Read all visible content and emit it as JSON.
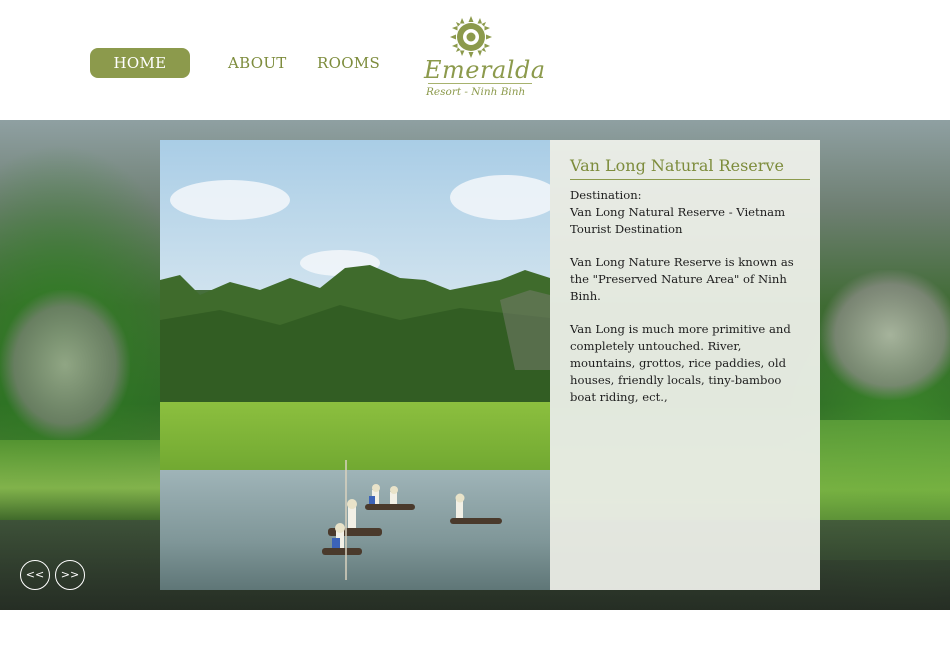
{
  "nav": {
    "home": "HOME",
    "about": "ABOUT",
    "rooms": "ROOMS"
  },
  "logo": {
    "name": "Emeralda",
    "subtitle": "Resort - Ninh Binh"
  },
  "slide": {
    "title": "Van Long Natural Reserve",
    "destination_label": "Destination:",
    "destination_value": "Van Long Natural Reserve - Vietnam Tourist Destination",
    "paragraph_1": "Van Long Nature Reserve is known as the \"Preserved Nature Area\" of Ninh Binh.",
    "paragraph_2": "Van Long is much more primitive and completely untouched. River, mountains, grottos, rice paddies, old houses, friendly locals, tiny-bamboo boat riding, ect.,"
  },
  "controls": {
    "prev": "<<",
    "next": ">>"
  },
  "colors": {
    "accent": "#8c9a4c",
    "accent_text": "#7d8c3c"
  }
}
